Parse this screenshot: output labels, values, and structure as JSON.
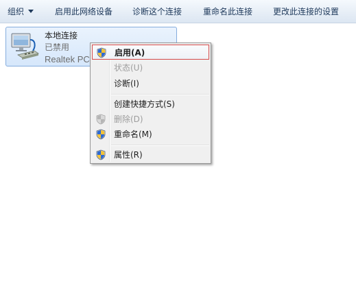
{
  "toolbar": {
    "organize": "组织",
    "enable_device": "启用此网络设备",
    "diagnose": "诊断这个连接",
    "rename": "重命名此连接",
    "change_settings": "更改此连接的设置"
  },
  "connection": {
    "name": "本地连接",
    "status": "已禁用",
    "device": "Realtek PCIe"
  },
  "context_menu": {
    "enable": "启用(A)",
    "status": "状态(U)",
    "diagnose": "诊断(I)",
    "create_shortcut": "创建快捷方式(S)",
    "delete": "删除(D)",
    "rename": "重命名(M)",
    "properties": "属性(R)"
  },
  "icons": {
    "organize_dropdown": "chevron-down-icon",
    "connection": "network-adapter-icon",
    "uac": "uac-shield-icon"
  },
  "colors": {
    "highlight_border": "#d44a4a",
    "selection_fill": "#d6e7fb",
    "disabled_text": "#9d9d9d"
  }
}
